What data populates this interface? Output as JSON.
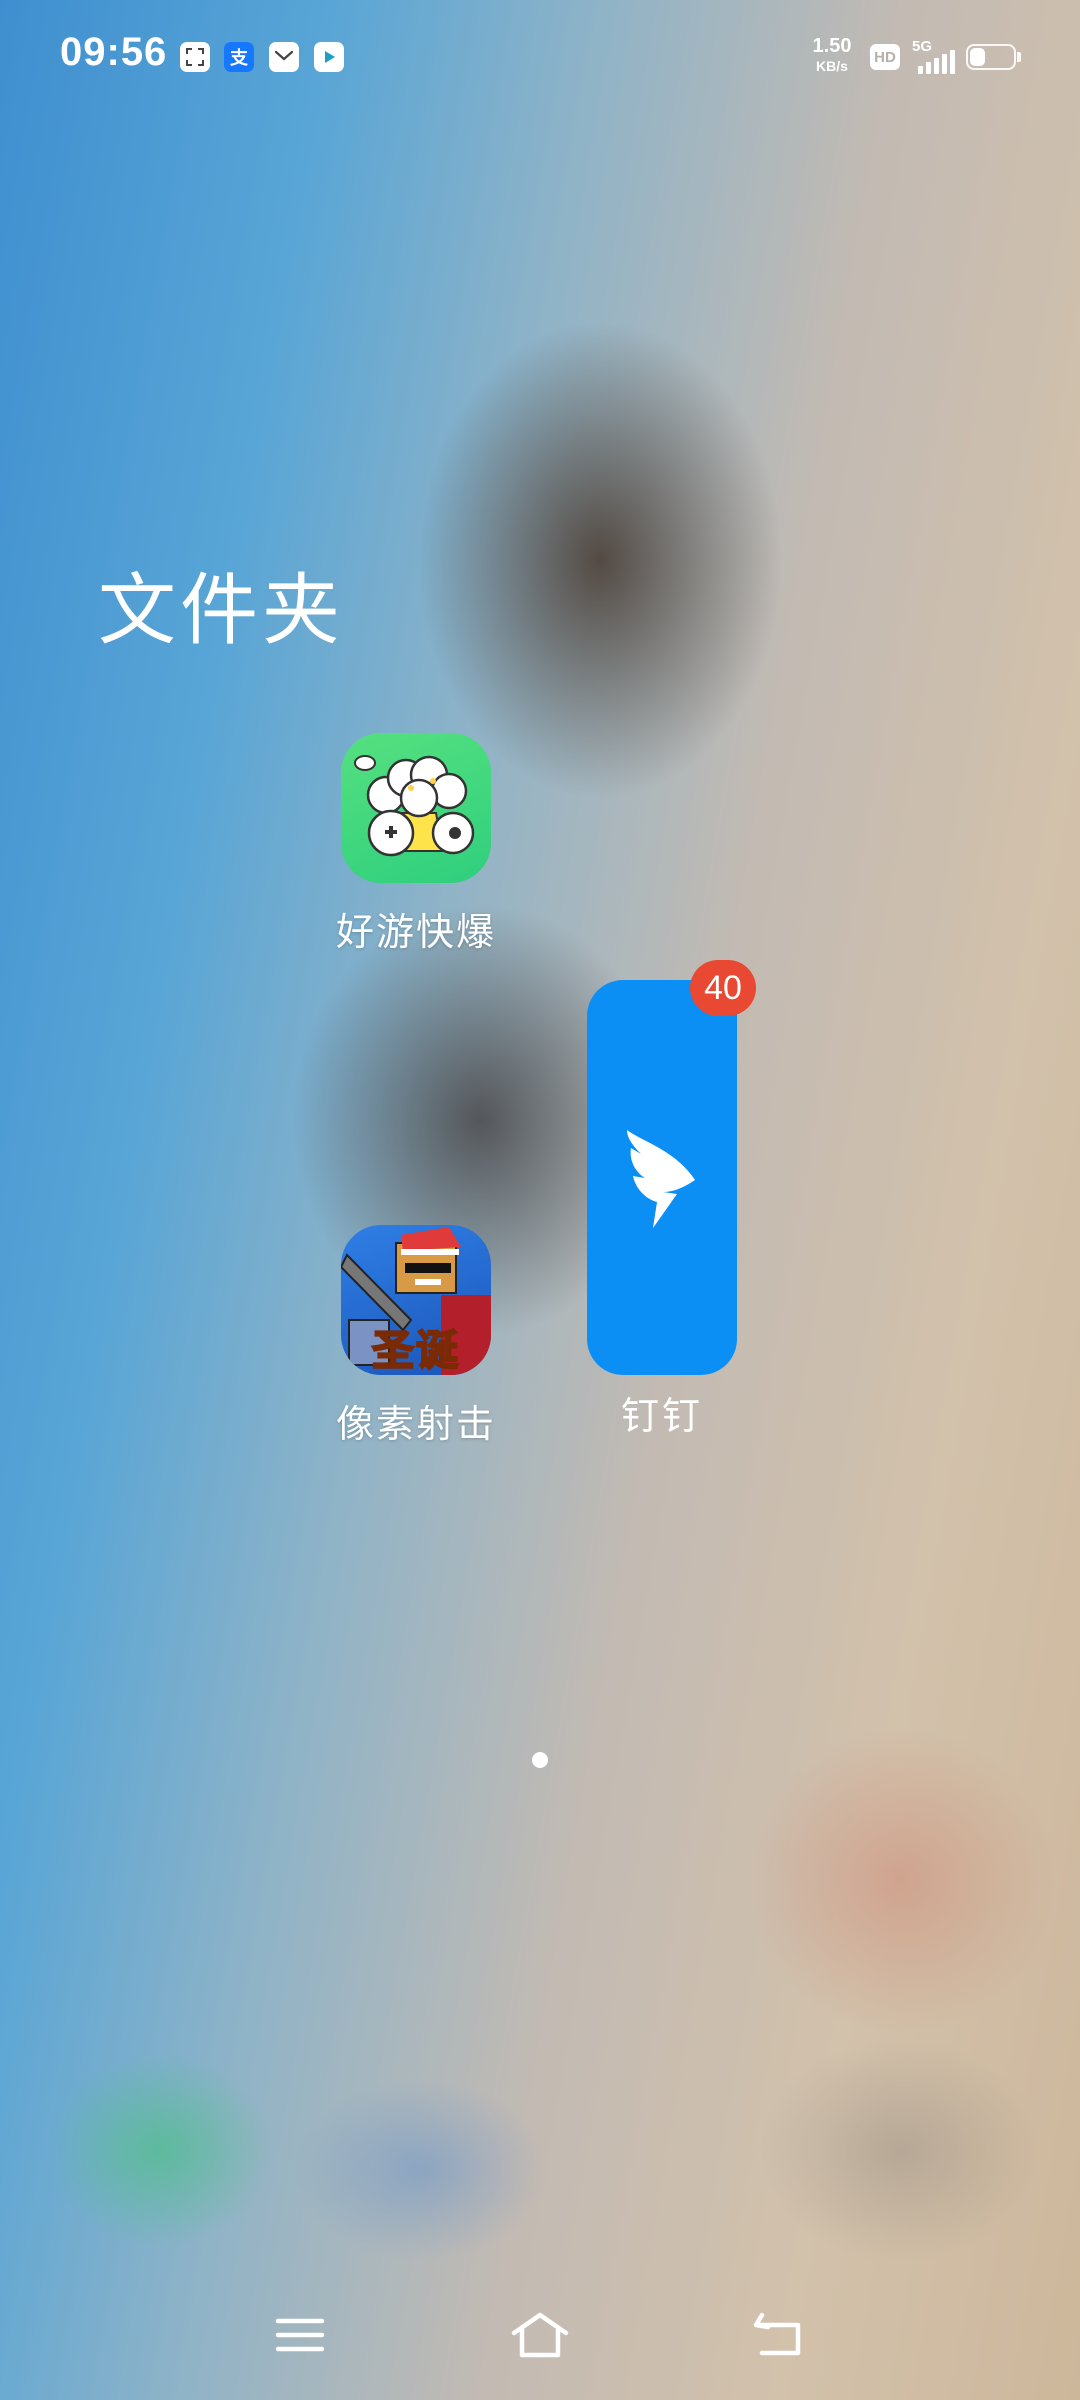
{
  "status_bar": {
    "time": "09:56",
    "notification_icons": [
      "scan-app-icon",
      "alipay-icon",
      "mail-app-icon",
      "video-play-app-icon"
    ],
    "alipay_glyph": "支",
    "network_speed_value": "1.50",
    "network_speed_unit": "KB/s",
    "hd_label": "HD",
    "network_type": "5G",
    "battery_level": 0.35
  },
  "folder": {
    "title": "文件夹",
    "apps": [
      {
        "label": "好游快爆",
        "icon": "haoyou-kuaibao-icon"
      },
      {
        "label": "像素射击",
        "icon": "pixel-shooter-icon",
        "icon_text": "圣诞"
      }
    ],
    "featured_app": {
      "label": "钉钉",
      "icon": "dingtalk-icon",
      "badge": "40",
      "color": "#0c8ff5"
    }
  },
  "page_indicator": {
    "pages": 1,
    "current": 1
  },
  "nav_bar": {
    "buttons": [
      "menu-icon",
      "home-icon",
      "back-icon"
    ]
  },
  "colors": {
    "badge": "#e94832",
    "haoyou_bg": "#3ed67a",
    "pixel_bg": "#2f7fe6"
  }
}
